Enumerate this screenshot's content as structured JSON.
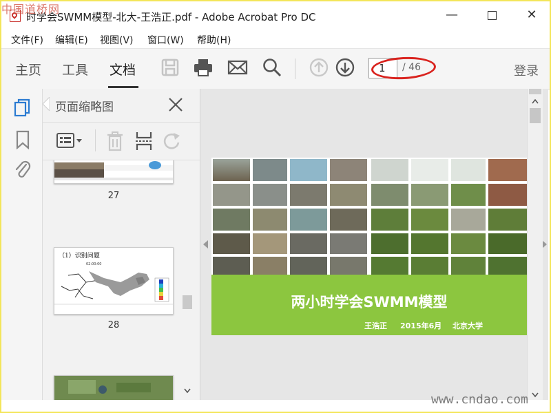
{
  "watermarks": {
    "top": "中国道桥网",
    "bottom": "www.cndao.com"
  },
  "window": {
    "title": "时学会SWMM模型-北大-王浩正.pdf - Adobe Acrobat Pro DC",
    "minimize": "—",
    "close": "✕"
  },
  "menu": [
    "文件(F)",
    "编辑(E)",
    "视图(V)",
    "窗口(W)",
    "帮助(H)"
  ],
  "tabs": [
    {
      "label": "主页",
      "active": false
    },
    {
      "label": "工具",
      "active": false
    },
    {
      "label": "文档",
      "active": true
    }
  ],
  "toolbar_icons": [
    "save-icon",
    "print-icon",
    "email-icon",
    "search-icon",
    "prev-page-icon",
    "next-page-icon"
  ],
  "page_nav": {
    "current": "1",
    "total": "/ 46"
  },
  "login": "登录",
  "rail_icons": [
    "page-thumbnails-icon",
    "bookmark-icon",
    "attachment-icon"
  ],
  "panel": {
    "title": "页面缩略图",
    "thumbnails": [
      {
        "number": "27"
      },
      {
        "number": "28",
        "heading": "（1）识别问题",
        "small_text": "02:00:00"
      },
      {
        "number": ""
      }
    ]
  },
  "slide": {
    "title": "两小时学会SWMM模型",
    "author": "王浩正",
    "date": "2015年6月",
    "org": "北京大学"
  },
  "colors": {
    "banner": "#8cc63f",
    "highlight": "#d9231e",
    "accent_blue": "#2b7bd1"
  }
}
